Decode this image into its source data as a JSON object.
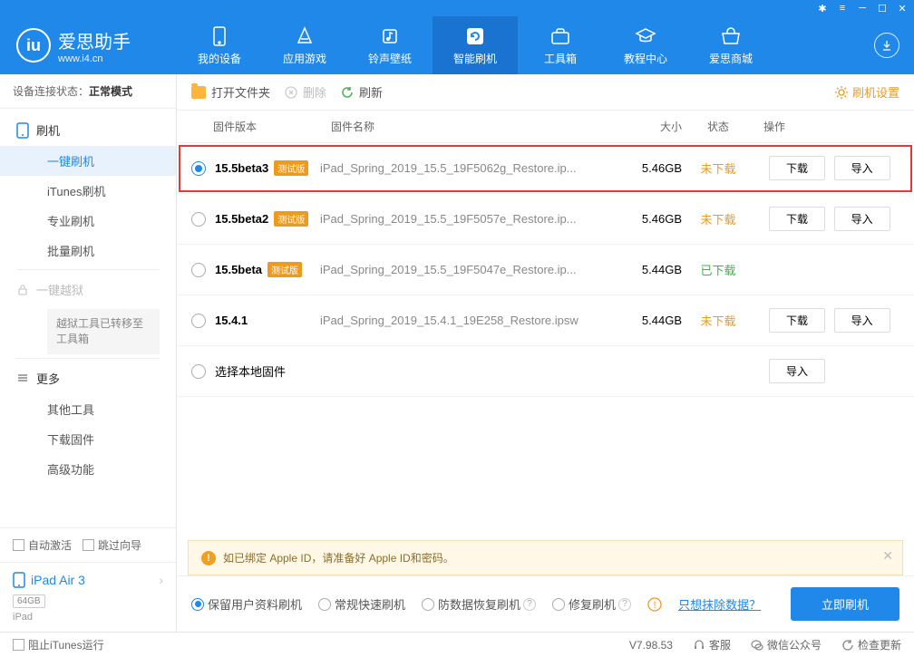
{
  "logo": {
    "title": "爱思助手",
    "url": "www.i4.cn",
    "mark": "iu"
  },
  "nav": {
    "items": [
      {
        "label": "我的设备"
      },
      {
        "label": "应用游戏"
      },
      {
        "label": "铃声壁纸"
      },
      {
        "label": "智能刷机",
        "active": true
      },
      {
        "label": "工具箱"
      },
      {
        "label": "教程中心"
      },
      {
        "label": "爱思商城"
      }
    ]
  },
  "sidebar": {
    "status_label": "设备连接状态：",
    "status_value": "正常模式",
    "flash_header": "刷机",
    "items": [
      "一键刷机",
      "iTunes刷机",
      "专业刷机",
      "批量刷机"
    ],
    "jailbreak": "一键越狱",
    "jailbreak_note": "越狱工具已转移至工具箱",
    "more_header": "更多",
    "more_items": [
      "其他工具",
      "下载固件",
      "高级功能"
    ],
    "auto_activate": "自动激活",
    "skip_guide": "跳过向导",
    "device_name": "iPad Air 3",
    "device_capacity": "64GB",
    "device_type": "iPad"
  },
  "toolbar": {
    "open": "打开文件夹",
    "delete": "删除",
    "refresh": "刷新",
    "settings": "刷机设置"
  },
  "table": {
    "headers": {
      "version": "固件版本",
      "name": "固件名称",
      "size": "大小",
      "status": "状态",
      "action": "操作"
    },
    "beta_tag": "测试版",
    "btn_download": "下载",
    "btn_import": "导入",
    "local_firmware": "选择本地固件",
    "rows": [
      {
        "version": "15.5beta3",
        "beta": true,
        "name": "iPad_Spring_2019_15.5_19F5062g_Restore.ip...",
        "size": "5.46GB",
        "status": "未下载",
        "status_class": "nd",
        "selected": true,
        "highlight": true,
        "download": true,
        "import": true
      },
      {
        "version": "15.5beta2",
        "beta": true,
        "name": "iPad_Spring_2019_15.5_19F5057e_Restore.ip...",
        "size": "5.46GB",
        "status": "未下载",
        "status_class": "nd",
        "download": true,
        "import": true
      },
      {
        "version": "15.5beta",
        "beta": true,
        "name": "iPad_Spring_2019_15.5_19F5047e_Restore.ip...",
        "size": "5.44GB",
        "status": "已下载",
        "status_class": "dl"
      },
      {
        "version": "15.4.1",
        "beta": false,
        "name": "iPad_Spring_2019_15.4.1_19E258_Restore.ipsw",
        "size": "5.44GB",
        "status": "未下载",
        "status_class": "nd",
        "download": true,
        "import": true
      }
    ]
  },
  "alert": "如已绑定 Apple ID，请准备好 Apple ID和密码。",
  "options": {
    "keep": "保留用户资料刷机",
    "fast": "常规快速刷机",
    "recover": "防数据恢复刷机",
    "repair": "修复刷机",
    "erase": "只想抹除数据？",
    "flash_btn": "立即刷机"
  },
  "statusbar": {
    "block_itunes": "阻止iTunes运行",
    "version": "V7.98.53",
    "support": "客服",
    "wechat": "微信公众号",
    "update": "检查更新"
  }
}
